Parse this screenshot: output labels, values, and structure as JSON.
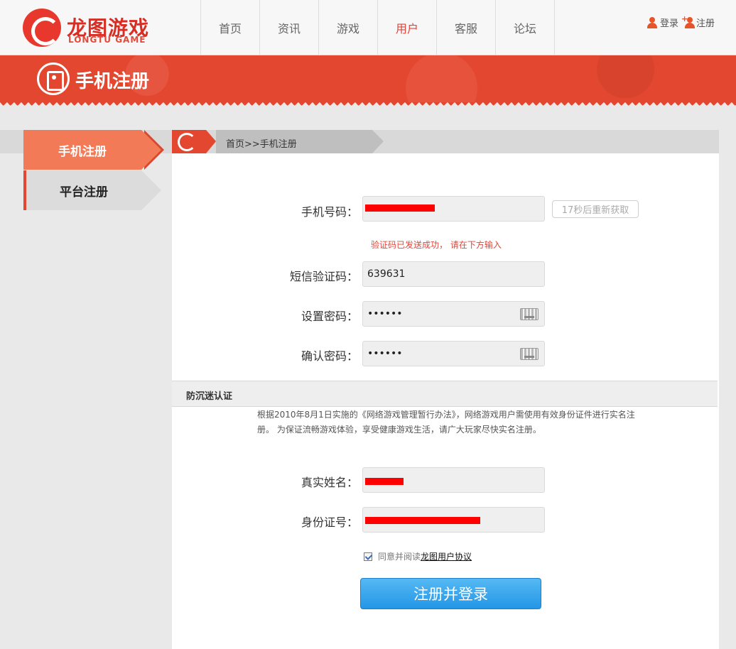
{
  "brand": {
    "name_cn": "龙图游戏",
    "name_en": "LONGTU GAME"
  },
  "nav": {
    "items": [
      "首页",
      "资讯",
      "游戏",
      "用户",
      "客服",
      "论坛"
    ],
    "active": "用户"
  },
  "user_links": {
    "login": "登录",
    "register": "注册"
  },
  "banner": {
    "title": "手机注册"
  },
  "sidebar": {
    "items": [
      {
        "label": "手机注册",
        "active": true
      },
      {
        "label": "平台注册",
        "active": false
      }
    ]
  },
  "breadcrumb": "首页>>手机注册",
  "form": {
    "phone_label": "手机号码：",
    "resend_label": "17秒后重新获取",
    "sent_hint": "验证码已发送成功， 请在下方输入",
    "sms_label": "短信验证码：",
    "sms_value": "639631",
    "password_label": "设置密码：",
    "password_value": "••••••",
    "confirm_label": "确认密码：",
    "confirm_value": "••••••"
  },
  "anti_addiction": {
    "title": "防沉迷认证",
    "notice": "根据2010年8月1日实施的《网络游戏管理暂行办法》，网络游戏用户需使用有效身份证件进行实名注册。 为保证流畅游戏体验，享受健康游戏生活，请广大玩家尽快实名注册。",
    "name_label": "真实姓名：",
    "id_label": "身份证号："
  },
  "agreement": {
    "prefix": "同意并阅读",
    "link": "龙图用户协议",
    "checked": true
  },
  "submit_label": "注册并登录",
  "colors": {
    "brand_red": "#e4472f",
    "button_blue": "#2496e6",
    "hint_red": "#e0463a"
  }
}
